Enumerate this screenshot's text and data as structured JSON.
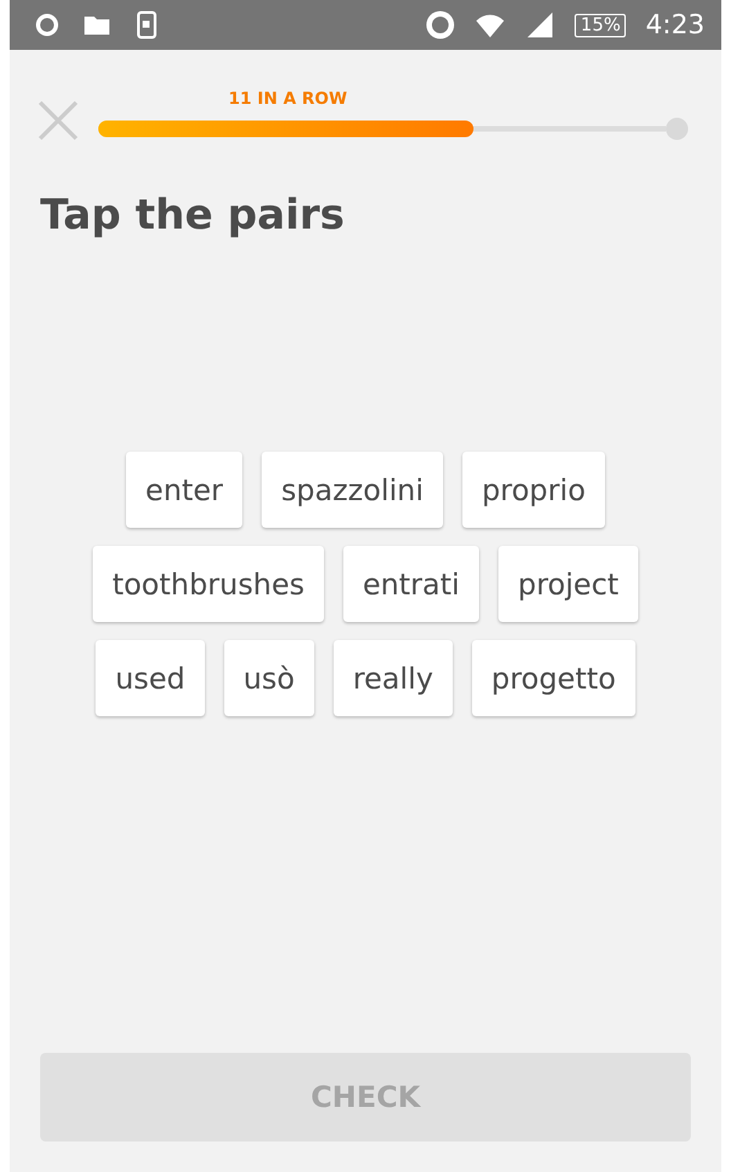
{
  "status_bar": {
    "battery": "15%",
    "time": "4:23"
  },
  "progress": {
    "streak": "11 IN A ROW",
    "level": 0.66
  },
  "title": "Tap the pairs",
  "word_rows": [
    [
      "enter",
      "spazzolini",
      "proprio"
    ],
    [
      "toothbrushes",
      "entrati",
      "project"
    ],
    [
      "used",
      "usò",
      "really",
      "progetto"
    ]
  ],
  "check_button": {
    "label": "CHECK",
    "disabled": true
  }
}
